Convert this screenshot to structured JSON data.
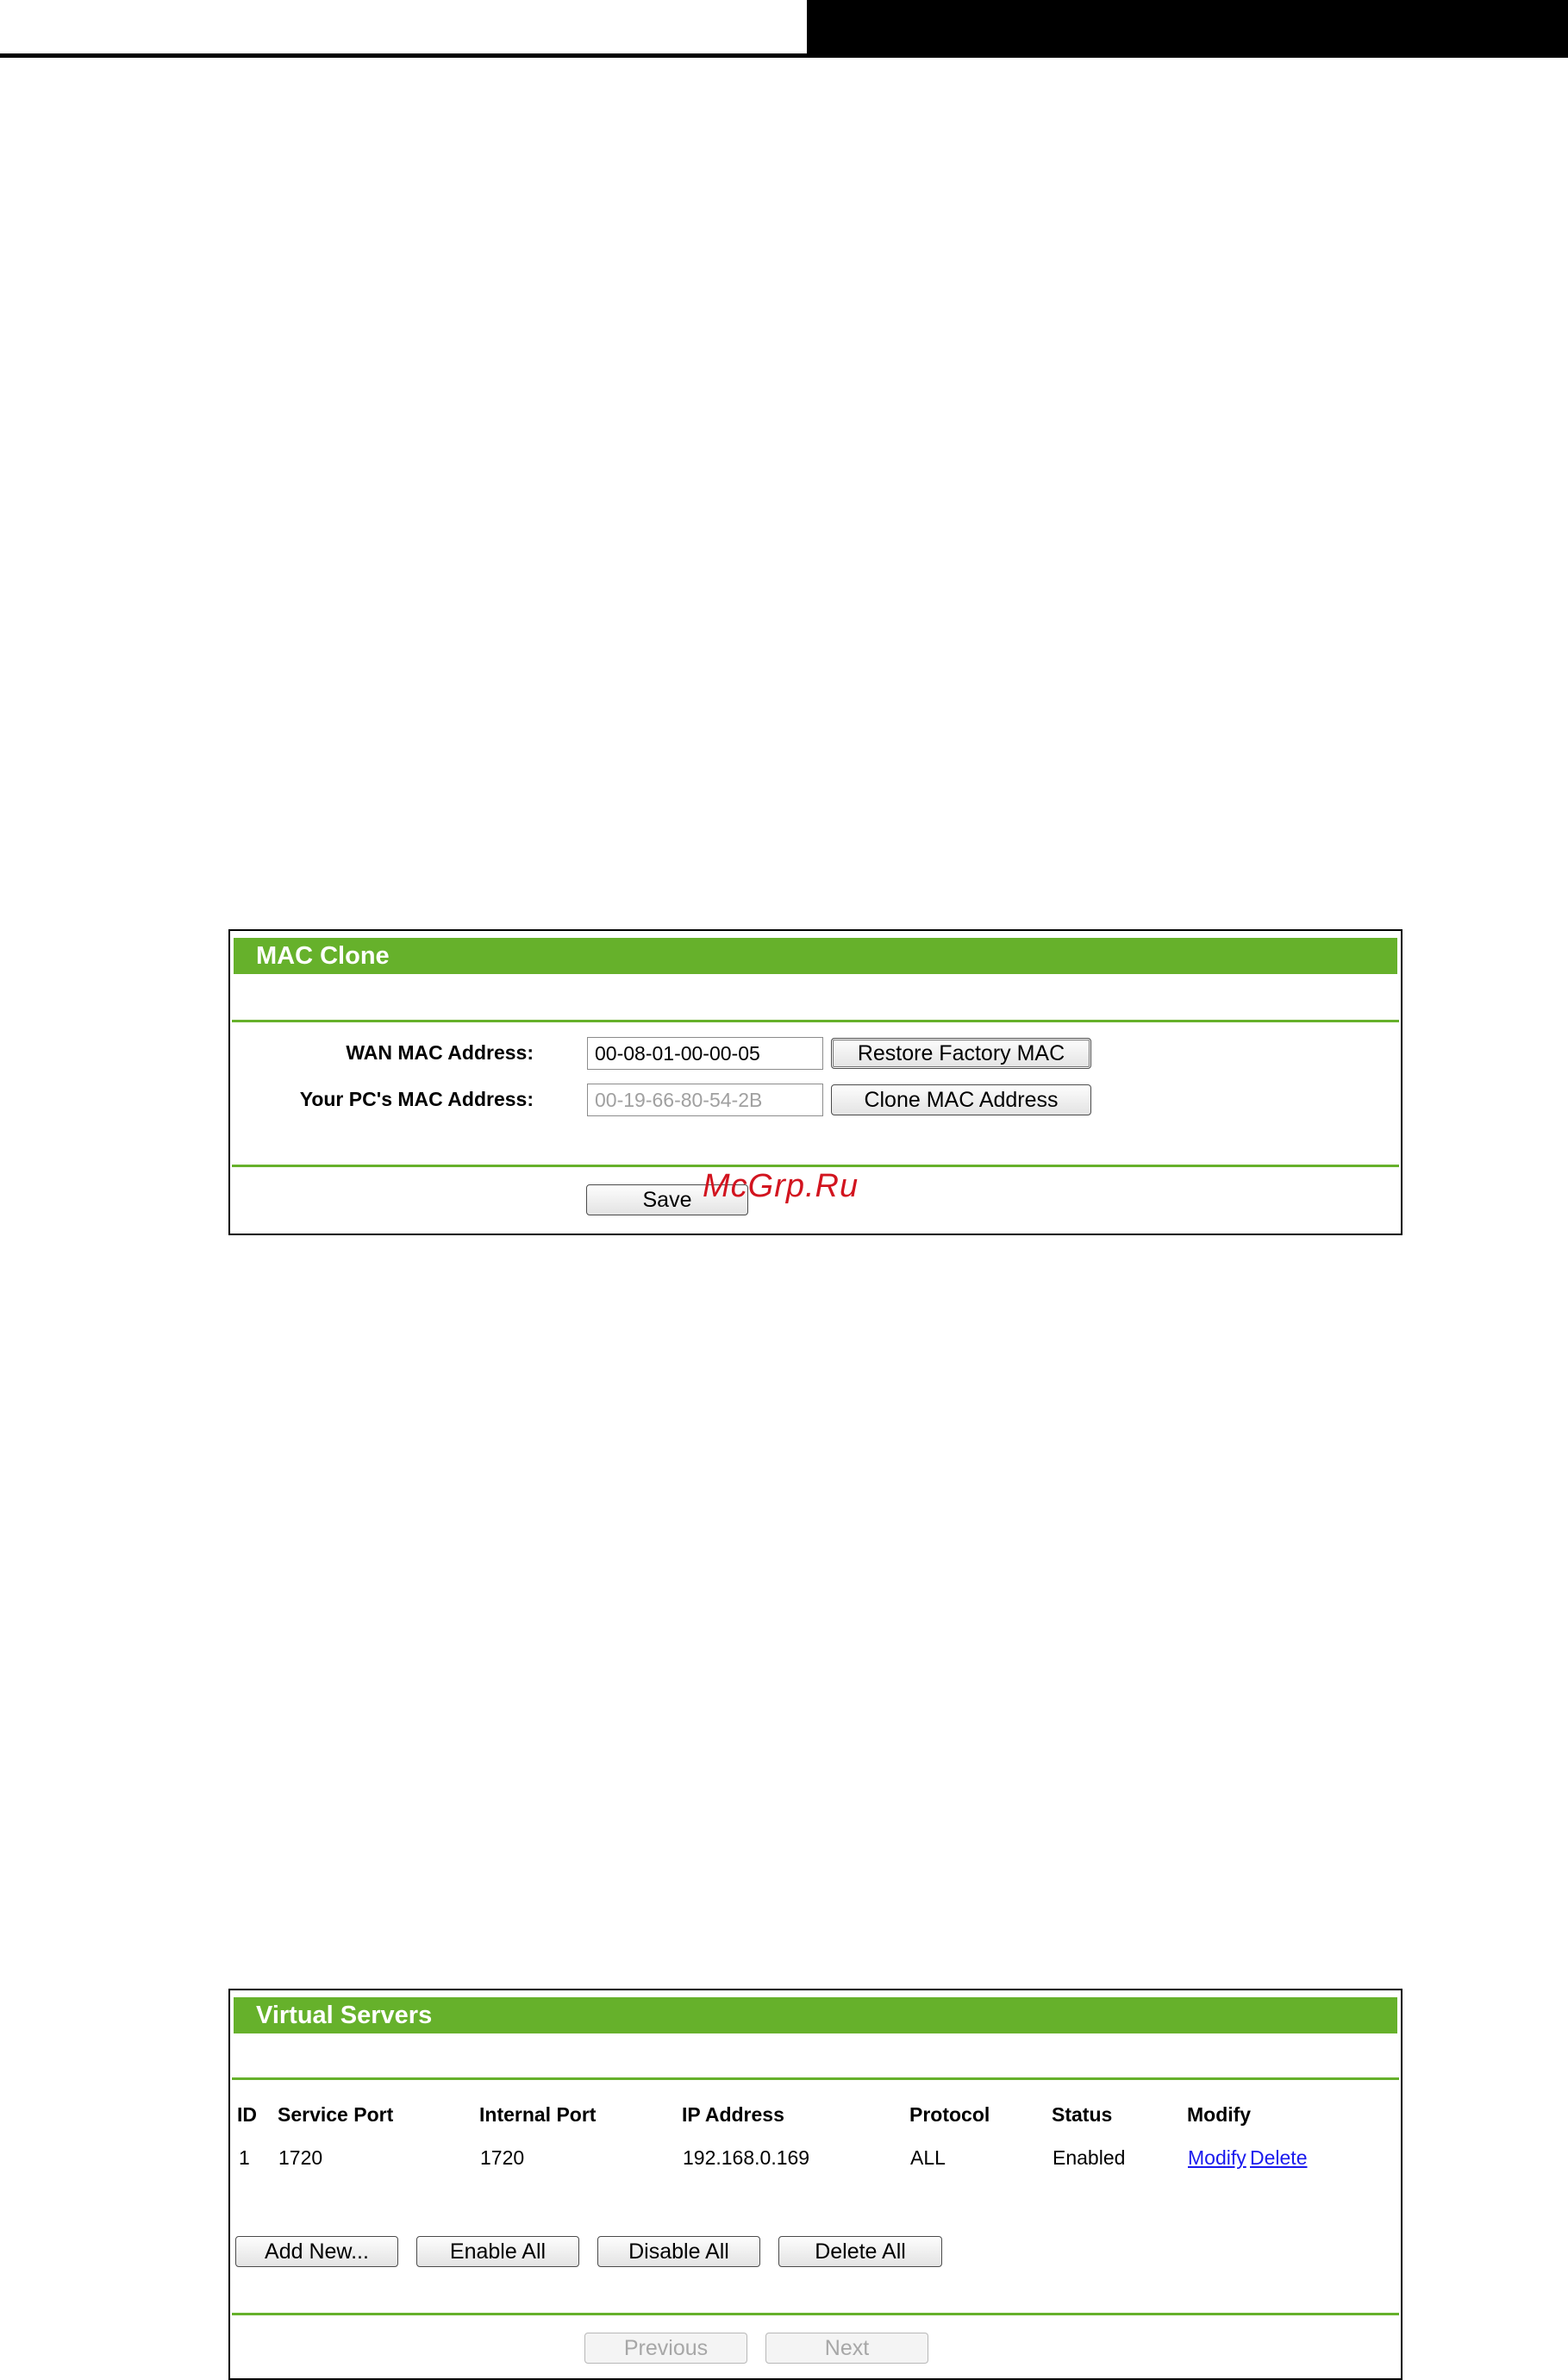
{
  "mac_clone": {
    "title": "MAC Clone",
    "wan_mac_label": "WAN MAC Address:",
    "wan_mac_value": "00-08-01-00-00-05",
    "pc_mac_label": "Your PC's MAC Address:",
    "pc_mac_value": "00-19-66-80-54-2B",
    "restore_button": "Restore Factory MAC",
    "clone_button": "Clone MAC Address",
    "save_button": "Save"
  },
  "watermark": "McGrp.Ru",
  "virtual_servers": {
    "title": "Virtual Servers",
    "columns": {
      "id": "ID",
      "service_port": "Service Port",
      "internal_port": "Internal Port",
      "ip_address": "IP Address",
      "protocol": "Protocol",
      "status": "Status",
      "modify": "Modify"
    },
    "rows": [
      {
        "id": "1",
        "service_port": "1720",
        "internal_port": "1720",
        "ip_address": "192.168.0.169",
        "protocol": "ALL",
        "status": "Enabled",
        "modify_link": "Modify",
        "delete_link": "Delete"
      }
    ],
    "add_new_button": "Add New...",
    "enable_all_button": "Enable All",
    "disable_all_button": "Disable All",
    "delete_all_button": "Delete All",
    "previous_button": "Previous",
    "next_button": "Next"
  },
  "colors": {
    "accent_green": "#66b12b",
    "link_blue": "#1a1aee",
    "watermark_red": "#d2141f"
  }
}
